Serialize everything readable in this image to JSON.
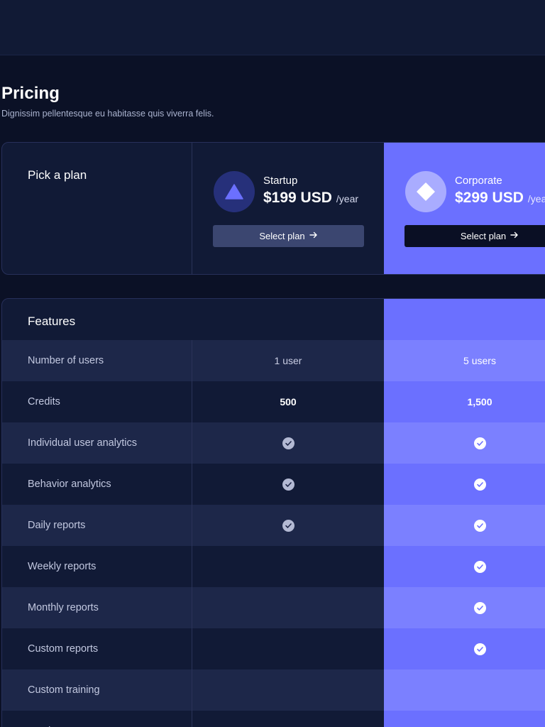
{
  "header": {
    "title": "Pricing",
    "subtitle": "Dignissim pellentesque eu habitasse quis viverra felis."
  },
  "plans": {
    "pick_label": "Pick a plan",
    "items": [
      {
        "name": "Startup",
        "price": "$199 USD",
        "period": "/year",
        "button": "Select plan",
        "icon": "triangle-icon"
      },
      {
        "name": "Corporate",
        "price": "$299 USD",
        "period": "/year",
        "button": "Select plan",
        "icon": "diamond-icon"
      }
    ]
  },
  "features": {
    "heading": "Features",
    "rows": [
      {
        "label": "Number of users",
        "startup": "1 user",
        "corporate": "5 users"
      },
      {
        "label": "Credits",
        "startup": "500",
        "corporate": "1,500"
      },
      {
        "label": "Individual user analytics",
        "startup": true,
        "corporate": true
      },
      {
        "label": "Behavior analytics",
        "startup": true,
        "corporate": true
      },
      {
        "label": "Daily reports",
        "startup": true,
        "corporate": true
      },
      {
        "label": "Weekly reports",
        "startup": false,
        "corporate": true
      },
      {
        "label": "Monthly reports",
        "startup": false,
        "corporate": true
      },
      {
        "label": "Custom reports",
        "startup": false,
        "corporate": true
      },
      {
        "label": "Custom training",
        "startup": false,
        "corporate": false
      },
      {
        "label": "Batch reports",
        "startup": false,
        "corporate": false
      }
    ]
  },
  "colors": {
    "accent": "#6b70ff",
    "background": "#0b1126",
    "panel": "#111a36"
  }
}
